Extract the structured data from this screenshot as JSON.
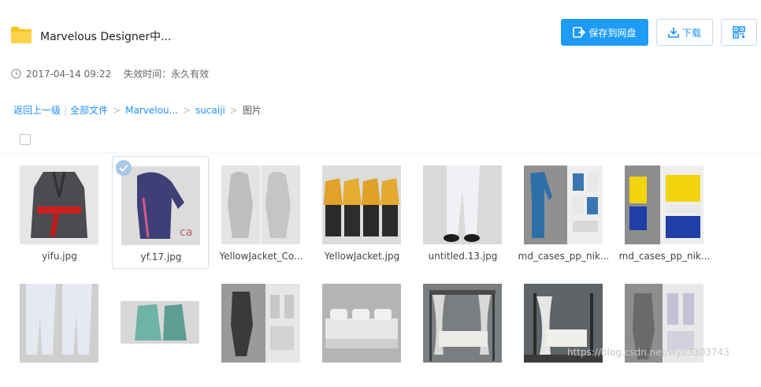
{
  "header": {
    "title": "Marvelous Designer中...",
    "save_button": "保存到网盘",
    "download_button": "下载",
    "qr_button_icon": "qrcode-icon",
    "folder_icon": "folder-icon",
    "colors": {
      "primary": "#1e9bf5",
      "link": "#1e90ff",
      "folder": "#f5c31b"
    }
  },
  "meta": {
    "date": "2017-04-14 09:22",
    "expire": "失效时间：永久有效"
  },
  "breadcrumb": {
    "back": "返回上一级",
    "all_files": "全部文件",
    "level1": "Marvelou...",
    "level2": "sucaiji",
    "current": "图片"
  },
  "files": [
    {
      "name": "yifu.jpg",
      "selected": false
    },
    {
      "name": "yf.17.jpg",
      "selected": true
    },
    {
      "name": "YellowJacket_Co...",
      "selected": false
    },
    {
      "name": "YellowJacket.jpg",
      "selected": false
    },
    {
      "name": "untitled.13.jpg",
      "selected": false
    },
    {
      "name": "md_cases_pp_nik...",
      "selected": false
    },
    {
      "name": "md_cases_pp_nik...",
      "selected": false
    },
    {
      "name": "",
      "selected": false
    },
    {
      "name": "",
      "selected": false
    },
    {
      "name": "",
      "selected": false
    },
    {
      "name": "",
      "selected": false
    },
    {
      "name": "",
      "selected": false
    },
    {
      "name": "",
      "selected": false
    },
    {
      "name": "",
      "selected": false
    }
  ],
  "watermark": "https://blog.csdn.net/wyx3303743"
}
